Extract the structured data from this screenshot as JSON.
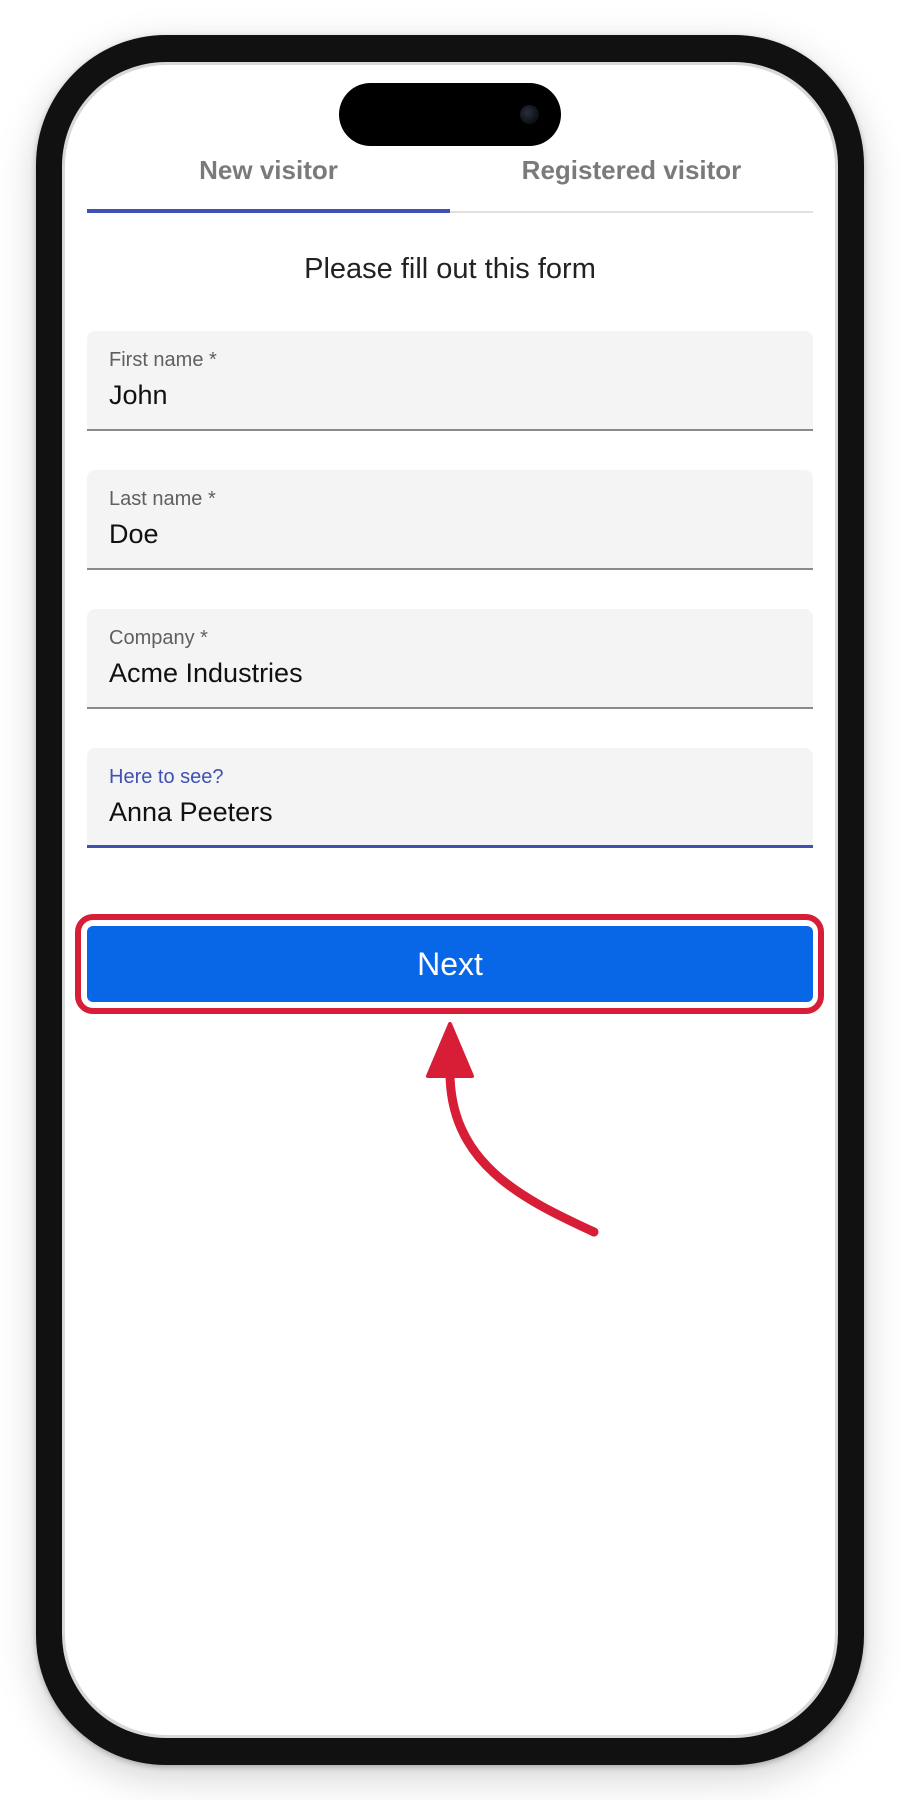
{
  "tabs": [
    {
      "label": "New visitor",
      "active": true
    },
    {
      "label": "Registered visitor",
      "active": false
    }
  ],
  "form": {
    "title": "Please fill out this form",
    "fields": [
      {
        "label": "First name *",
        "value": "John"
      },
      {
        "label": "Last name *",
        "value": "Doe"
      },
      {
        "label": "Company *",
        "value": "Acme Industries"
      },
      {
        "label": "Here to see?",
        "value": "Anna Peeters",
        "focused": true
      }
    ]
  },
  "next_button": {
    "label": "Next"
  },
  "colors": {
    "accent": "#3f51b5",
    "button": "#0867e6",
    "annotation": "#d81e36"
  },
  "annotation": {
    "icon": "curved-arrow-up-icon"
  }
}
